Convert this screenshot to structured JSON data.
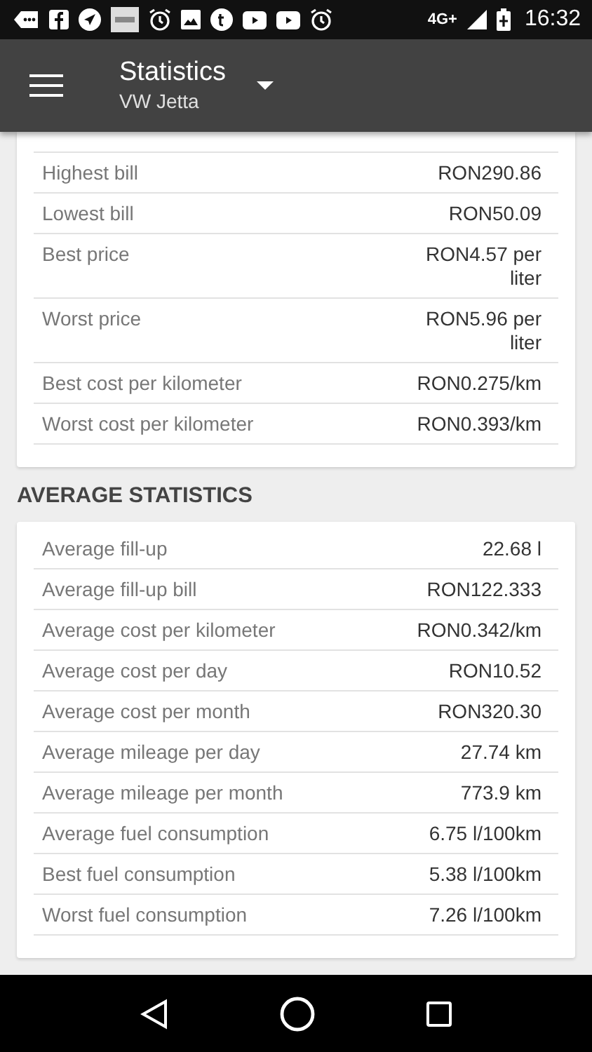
{
  "status_bar": {
    "network": "4G+",
    "time": "16:32"
  },
  "app_bar": {
    "title": "Statistics",
    "subtitle": "VW Jetta"
  },
  "sections": [
    {
      "rows": [
        {
          "label": "Highest bill",
          "value": "RON290.86"
        },
        {
          "label": "Lowest bill",
          "value": "RON50.09"
        },
        {
          "label": "Best price",
          "value": "RON4.57 per liter"
        },
        {
          "label": "Worst price",
          "value": "RON5.96 per liter"
        },
        {
          "label": "Best cost per kilometer",
          "value": "RON0.275/km"
        },
        {
          "label": "Worst cost per kilometer",
          "value": "RON0.393/km"
        }
      ]
    },
    {
      "title": "AVERAGE STATISTICS",
      "rows": [
        {
          "label": "Average fill-up",
          "value": "22.68 l"
        },
        {
          "label": "Average fill-up bill",
          "value": "RON122.333"
        },
        {
          "label": "Average cost per kilometer",
          "value": "RON0.342/km"
        },
        {
          "label": "Average cost per day",
          "value": "RON10.52"
        },
        {
          "label": "Average cost per month",
          "value": "RON320.30"
        },
        {
          "label": "Average mileage per day",
          "value": "27.74 km"
        },
        {
          "label": "Average mileage per month",
          "value": "773.9 km"
        },
        {
          "label": "Average fuel consumption",
          "value": "6.75 l/100km"
        },
        {
          "label": "Best fuel consumption",
          "value": "5.38 l/100km"
        },
        {
          "label": "Worst fuel consumption",
          "value": "7.26 l/100km"
        }
      ]
    }
  ]
}
